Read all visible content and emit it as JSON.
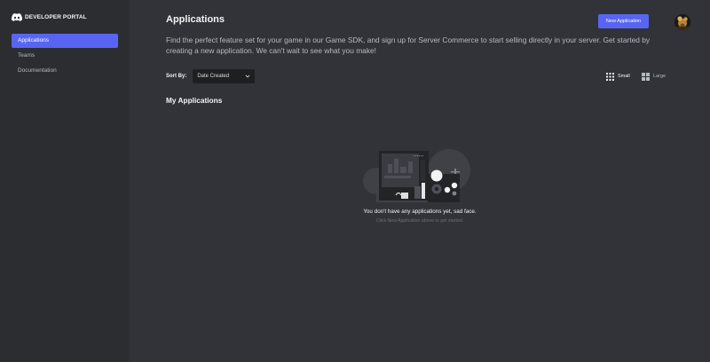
{
  "brand": {
    "name": "DEVELOPER PORTAL",
    "logo_icon": "discord-logo-icon"
  },
  "sidebar": {
    "items": [
      {
        "label": "Applications",
        "active": true
      },
      {
        "label": "Teams",
        "active": false
      },
      {
        "label": "Documentation",
        "active": false
      }
    ]
  },
  "header": {
    "title": "Applications",
    "new_button": "New Application",
    "description": "Find the perfect feature set for your game in our Game SDK, and sign up for Server Commerce to start selling directly in your server. Get started by creating a new application. We can't wait to see what you make!"
  },
  "toolbar": {
    "sort_label": "Sort By:",
    "sort_value": "Date Created",
    "view_small": "Small",
    "view_large": "Large"
  },
  "section": {
    "title": "My Applications"
  },
  "empty_state": {
    "title": "You don't have any applications yet, sad face.",
    "subtitle": "Click New Application above to get started."
  },
  "colors": {
    "accent": "#5865f2",
    "background": "#313338",
    "sidebar": "#2b2d31",
    "input": "#1e1f22"
  }
}
